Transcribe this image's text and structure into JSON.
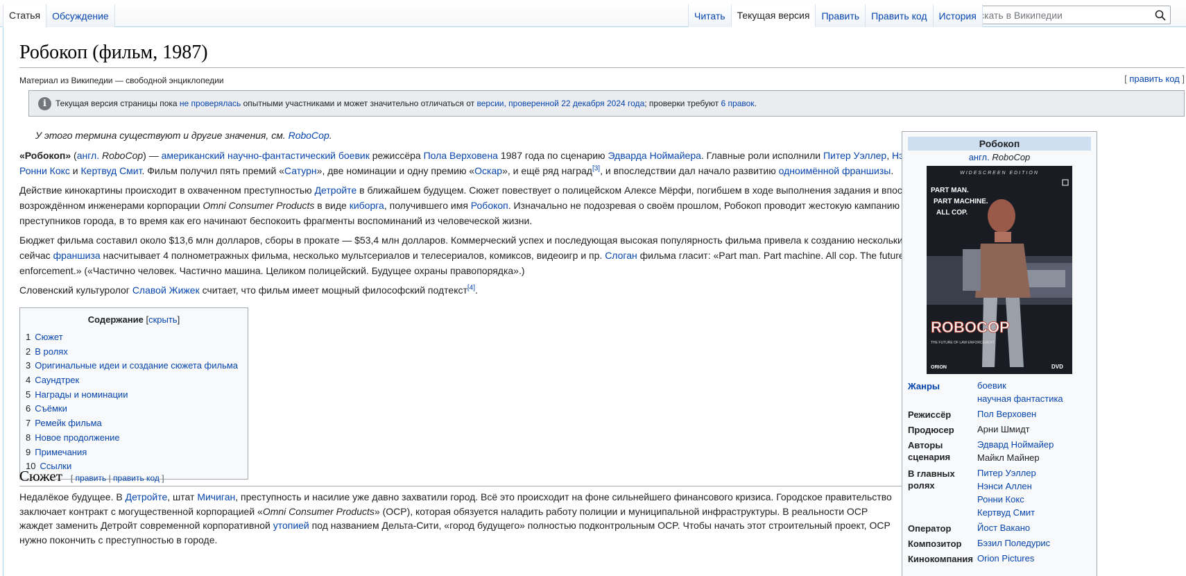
{
  "tabs_left": [
    {
      "label": "Статья",
      "selected": true
    },
    {
      "label": "Обсуждение",
      "selected": false
    }
  ],
  "tabs_right": [
    {
      "label": "Читать",
      "selected": false
    },
    {
      "label": "Текущая версия",
      "selected": true
    },
    {
      "label": "Править",
      "selected": false
    },
    {
      "label": "Править код",
      "selected": false
    },
    {
      "label": "История",
      "selected": false
    }
  ],
  "search": {
    "placeholder": "Искать в Википедии"
  },
  "title": "Робокоп (фильм, 1987)",
  "tagline": "Материал из Википедии — свободной энциклопедии",
  "edit_code_top": {
    "bracket_open": "[ ",
    "link": "править код",
    "bracket_close": " ]"
  },
  "notice": {
    "t1": "Текущая версия страницы пока ",
    "l1": "не проверялась",
    "t2": " опытными участниками и может значительно отличаться от ",
    "l2": "версии, проверенной 22 декабря 2024 года",
    "t3": "; проверки требуют ",
    "l3": "6 правок",
    "t4": "."
  },
  "hatnote": {
    "text": "У этого термина существуют и другие значения, см. ",
    "link": "RoboCop",
    "end": "."
  },
  "p1": {
    "b": "«Робокоп»",
    "t1": " (",
    "l_angl": "англ.",
    "i_orig": " RoboCop",
    "t2": ") — ",
    "l1": "американский научно-фантастический боевик",
    "t3": " режиссёра ",
    "l2": "Пола Верховена",
    "t4": " 1987 года по сценарию ",
    "l3": "Эдварда Ноймайера",
    "t5": ". Главные роли исполнили ",
    "l4": "Питер Уэллер",
    "t6": ", ",
    "l5": "Нэнси Аллен",
    "t7": ", ",
    "l6": "Ронни Кокс",
    "t8": " и ",
    "l7": "Кертвуд Смит",
    "t9": ". Фильм получил пять премий «",
    "l8": "Сатурн",
    "t10": "», две номинации и одну премию «",
    "l9": "Оскар",
    "t11": "», и ещё ряд наград",
    "ref": "[3]",
    "t12": ", и впоследствии дал начало развитию ",
    "l10": "одноимённой франшизы",
    "t13": "."
  },
  "p2": {
    "t1": "Действие кинокартины происходит в охваченном преступностью ",
    "l1": "Детройте",
    "t2": " в ближайшем будущем. Сюжет повествует о полицейском Алексе Мёрфи, погибшем в ходе выполнения задания и впоследствии возрождённом инженерами корпорации ",
    "i1": "Omni Consumer Products",
    "t3": " в виде ",
    "l2": "киборга",
    "t4": ", получившего имя ",
    "l3": "Робокоп",
    "t5": ". Изначально не подозревая о своём прошлом, Робокоп проводит жестокую кампанию против преступников города, в то время как его начинают беспокоить фрагменты воспоминаний из человеческой жизни."
  },
  "p3": {
    "t1": "Бюджет фильма составил около $13,6 млн долларов, сборы в прокате — $53,4 млн долларов. Коммерческий успех и последующая высокая популярность фильма привела к созданию нескольких сиквелов, сейчас ",
    "l1": "франшиза",
    "t2": " насчитывает 4 полнометражных фильма, несколько мультсериалов и телесериалов, комиксов, видеоигр и пр. ",
    "l2": "Слоган",
    "t3": " фильма гласит: «Part man. Part machine. All cop. The future of law enforcement.» («Частично человек. Частично машина. Целиком полицейский. Будущее охраны правопорядка».)"
  },
  "p4": {
    "t1": "Словенский культуролог ",
    "l1": "Славой Жижек",
    "t2": " считает, что фильм имеет мощный философский подтекст",
    "ref": "[4]",
    "t3": "."
  },
  "toc": {
    "title": "Содержание",
    "open": " [",
    "hide": "скрыть",
    "close": "]",
    "items": [
      {
        "num": "1",
        "label": "Сюжет"
      },
      {
        "num": "2",
        "label": "В ролях"
      },
      {
        "num": "3",
        "label": "Оригинальные идеи и создание сюжета фильма"
      },
      {
        "num": "4",
        "label": "Саундтрек"
      },
      {
        "num": "5",
        "label": "Награды и номинации"
      },
      {
        "num": "6",
        "label": "Съёмки"
      },
      {
        "num": "7",
        "label": "Ремейк фильма"
      },
      {
        "num": "8",
        "label": "Новое продолжение"
      },
      {
        "num": "9",
        "label": "Примечания"
      },
      {
        "num": "10",
        "label": "Ссылки"
      }
    ]
  },
  "section1": {
    "title": "Сюжет",
    "edit_open": "[ ",
    "edit": "править",
    "sep": " | ",
    "edit_code": "править код",
    "edit_close": " ]",
    "t1": "Недалёкое будущее. В ",
    "l1": "Детройте",
    "t2": ", штат ",
    "l2": "Мичиган",
    "t3": ", преступность и насилие уже давно захватили город. Всё это происходит на фоне сильнейшего финансового кризиса. Городское правительство заключает контракт с могущественной корпорацией «",
    "i1": "Omni Consumer Products",
    "t4": "» (OCP), которая обязуется наладить работу полиции и муниципальной инфраструктуры. В реальности OCP жаждет заменить Детройт современной корпоративной ",
    "l3": "утопией",
    "t5": " под названием Дельта-Сити, «город будущего» полностью подконтрольным OCP. Чтобы начать этот строительный проект, OCP нужно покончить с преступностью в городе."
  },
  "infobox": {
    "title": "Робокоп",
    "orig_lang": "англ.",
    "orig_title": " RoboCop",
    "poster_text": {
      "edition": "WIDESCREEN EDITION",
      "l1": "PART MAN.",
      "l2": "PART MACHINE.",
      "l3": "ALL COP.",
      "logo": "ROBOCOP",
      "tag": "THE FUTURE OF LAW ENFORCEMENT.",
      "studio": "ORION",
      "dvd": "DVD"
    },
    "rows": {
      "genres": {
        "label": "Жанры",
        "v": [
          "боевик",
          "научная фантастика"
        ]
      },
      "director": {
        "label": "Режиссёр",
        "v": [
          "Пол Верховен"
        ]
      },
      "producer": {
        "label": "Продюсер",
        "v": [
          "Арни Шмидт"
        ]
      },
      "writers": {
        "label": "Авторы сценария",
        "v": [
          "Эдвард Ноймайер",
          "Майкл Майнер"
        ]
      },
      "starring": {
        "label": "В главных ролях",
        "v": [
          "Питер Уэллер",
          "Нэнси Аллен",
          "Ронни Кокс",
          "Кертвуд Смит"
        ]
      },
      "operator": {
        "label": "Оператор",
        "v": [
          "Йост Вакано"
        ]
      },
      "composer": {
        "label": "Композитор",
        "v": [
          "Бэзил Поледурис"
        ]
      },
      "company": {
        "label": "Кинокомпания",
        "v": [
          "Orion Pictures"
        ]
      }
    }
  },
  "colors": {
    "link": "#0645ad",
    "border": "#a2a9b1",
    "infobox_header": "#cedff2",
    "tab_border": "#a7d7f9"
  }
}
